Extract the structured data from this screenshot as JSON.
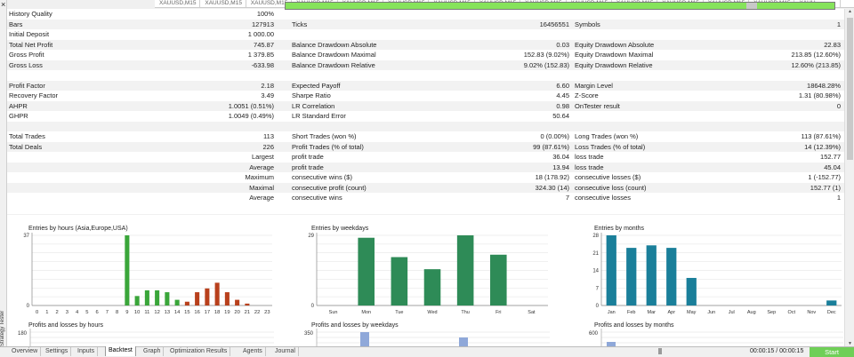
{
  "top_tabs": [
    "XAUUSD,M15",
    "XAUUSD,M15",
    "XAUUSD,M15",
    "XAUUSD,M15",
    "XAUUSD,M15",
    "XAUUSD,M15",
    "XAUUSD,M15",
    "XAUUSD,M15",
    "XAUUSD,M15",
    "XAUUSD,M15",
    "XAUUSD,M15",
    "XAUUSD,M15",
    "XAUUSD,M15",
    "XAUUSD,M15",
    "XAUU"
  ],
  "side_label": "Strategy Tester",
  "report": {
    "history_quality": {
      "label": "History Quality",
      "value": "100%",
      "fraction": 1.0
    },
    "rows": [
      [
        "Bars",
        "127913",
        "Ticks",
        "16456551",
        "Symbols",
        "1"
      ],
      [
        "Initial Deposit",
        "1 000.00",
        "",
        "",
        "",
        ""
      ],
      [
        "Total Net Profit",
        "745.87",
        "Balance Drawdown Absolute",
        "0.03",
        "Equity Drawdown Absolute",
        "22.83"
      ],
      [
        "Gross Profit",
        "1 379.85",
        "Balance Drawdown Maximal",
        "152.83 (9.02%)",
        "Equity Drawdown Maximal",
        "213.85 (12.60%)"
      ],
      [
        "Gross Loss",
        "-633.98",
        "Balance Drawdown Relative",
        "9.02% (152.83)",
        "Equity Drawdown Relative",
        "12.60% (213.85)"
      ],
      [
        "",
        "",
        "",
        "",
        "",
        ""
      ],
      [
        "Profit Factor",
        "2.18",
        "Expected Payoff",
        "6.60",
        "Margin Level",
        "18648.28%"
      ],
      [
        "Recovery Factor",
        "3.49",
        "Sharpe Ratio",
        "4.45",
        "Z-Score",
        "1.31 (80.98%)"
      ],
      [
        "AHPR",
        "1.0051 (0.51%)",
        "LR Correlation",
        "0.98",
        "OnTester result",
        "0"
      ],
      [
        "GHPR",
        "1.0049 (0.49%)",
        "LR Standard Error",
        "50.64",
        "",
        ""
      ],
      [
        "",
        "",
        "",
        "",
        "",
        ""
      ],
      [
        "Total Trades",
        "113",
        "Short Trades (won %)",
        "0 (0.00%)",
        "Long Trades (won %)",
        "113 (87.61%)"
      ],
      [
        "Total Deals",
        "226",
        "Profit Trades (% of total)",
        "99 (87.61%)",
        "Loss Trades (% of total)",
        "14 (12.39%)"
      ],
      [
        "",
        "Largest",
        "profit trade",
        "36.04",
        "loss trade",
        "152.77"
      ],
      [
        "",
        "Average",
        "profit trade",
        "13.94",
        "loss trade",
        "45.04"
      ],
      [
        "",
        "Maximum",
        "consecutive wins ($)",
        "18 (178.92)",
        "consecutive losses ($)",
        "1 (-152.77)"
      ],
      [
        "",
        "Maximal",
        "consecutive profit (count)",
        "324.30 (14)",
        "consecutive loss (count)",
        "152.77 (1)"
      ],
      [
        "",
        "Average",
        "consecutive wins",
        "7",
        "consecutive losses",
        "1"
      ]
    ]
  },
  "charts": {
    "hours": {
      "title": "Entries by hours (Asia,Europe,USA)",
      "y_top_label": "37",
      "y_bottom_label": "0",
      "categories": [
        "0",
        "1",
        "2",
        "3",
        "4",
        "5",
        "6",
        "7",
        "8",
        "9",
        "10",
        "11",
        "12",
        "13",
        "14",
        "15",
        "16",
        "17",
        "18",
        "19",
        "20",
        "21",
        "22",
        "23"
      ],
      "green": [
        0,
        0,
        0,
        0,
        0,
        0,
        0,
        0,
        0,
        37,
        5,
        8,
        8,
        7,
        3,
        0,
        0,
        0,
        0,
        0,
        0,
        0,
        0,
        0
      ],
      "red": [
        0,
        0,
        0,
        0,
        0,
        0,
        0,
        0,
        0,
        0,
        0,
        0,
        0,
        0,
        0,
        2,
        7,
        9,
        12,
        7,
        3,
        1,
        0,
        0
      ],
      "ylim": [
        0,
        37
      ],
      "green_color": "#3aa63a",
      "red_color": "#b8401c"
    },
    "weekdays": {
      "title": "Entries by weekdays",
      "y_top_label": "29",
      "y_bottom_label": "0",
      "categories": [
        "Sun",
        "Mon",
        "Tue",
        "Wed",
        "Thu",
        "Fri",
        "Sat"
      ],
      "values": [
        0,
        28,
        20,
        15,
        29,
        21,
        0
      ],
      "ylim": [
        0,
        29
      ],
      "color": "#2e8b57"
    },
    "months": {
      "title": "Entries by months",
      "y_ticks": [
        "28",
        "21",
        "14",
        "7",
        "0"
      ],
      "categories": [
        "Jan",
        "Feb",
        "Mar",
        "Apr",
        "May",
        "Jun",
        "Jul",
        "Aug",
        "Sep",
        "Oct",
        "Nov",
        "Dec"
      ],
      "values": [
        28,
        23,
        24,
        23,
        11,
        0,
        0,
        0,
        0,
        0,
        0,
        2
      ],
      "ylim": [
        0,
        28
      ],
      "color": "#1a7f9a"
    },
    "profits_hours": {
      "title": "Profits and losses by hours",
      "y_label": "180"
    },
    "profits_weekdays": {
      "title": "Profits and losses by weekdays",
      "y_label": "350"
    },
    "profits_months": {
      "title": "Profits and losses by months",
      "y_label": "600"
    }
  },
  "bottom_tabs": [
    "Overview",
    "Settings",
    "Inputs",
    "Backtest",
    "Graph",
    "Optimization Results",
    "Agents",
    "Journal"
  ],
  "active_tab": "Backtest",
  "timer": "00:00:15 / 00:00:15",
  "start_label": "Start"
}
